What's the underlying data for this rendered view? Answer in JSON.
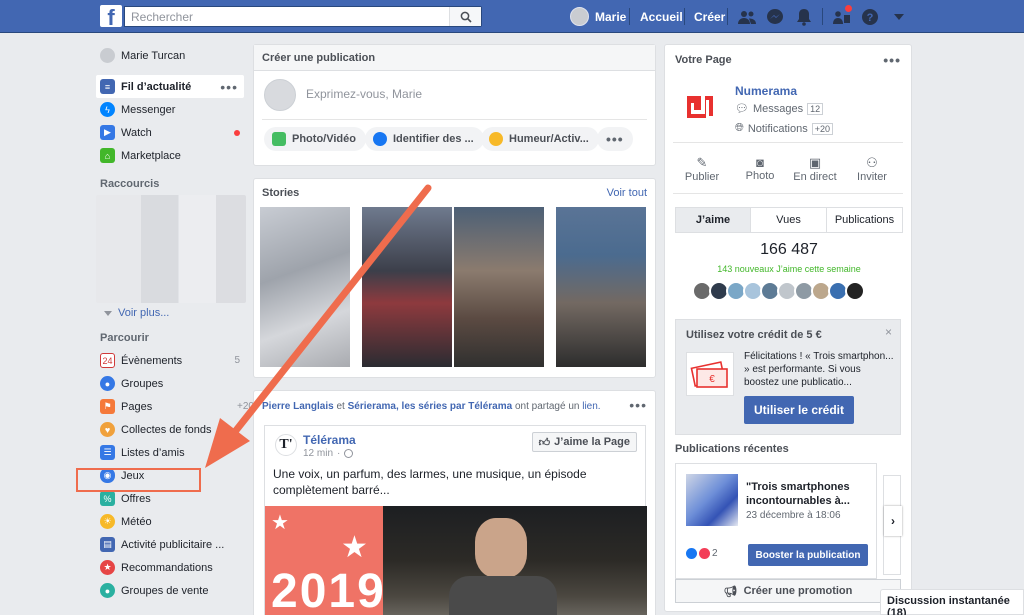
{
  "topbar": {
    "search_placeholder": "Rechercher",
    "user_name": "Marie",
    "home_label": "Accueil",
    "create_label": "Créer"
  },
  "leftnav": {
    "profile_name": "Marie Turcan",
    "main_items": [
      {
        "label": "Fil d’actualité",
        "icon": "news-feed-icon",
        "color": "#4267b2"
      },
      {
        "label": "Messenger",
        "icon": "messenger-icon",
        "color": "#0084ff"
      },
      {
        "label": "Watch",
        "icon": "watch-icon",
        "color": "#3578e5"
      },
      {
        "label": "Marketplace",
        "icon": "marketplace-icon",
        "color": "#42b72a"
      }
    ],
    "shortcuts_heading": "Raccourcis",
    "see_more": "Voir plus...",
    "explore_heading": "Parcourir",
    "explore_items": [
      {
        "label": "Évènements",
        "icon": "calendar-icon",
        "count": "5"
      },
      {
        "label": "Groupes",
        "icon": "groups-icon",
        "count": ""
      },
      {
        "label": "Pages",
        "icon": "pages-flag-icon",
        "count": "+20"
      },
      {
        "label": "Collectes de fonds",
        "icon": "fundraiser-icon",
        "count": ""
      },
      {
        "label": "Listes d’amis",
        "icon": "friend-lists-icon",
        "count": ""
      },
      {
        "label": "Jeux",
        "icon": "games-icon",
        "count": ""
      },
      {
        "label": "Offres",
        "icon": "offers-icon",
        "count": ""
      },
      {
        "label": "Météo",
        "icon": "weather-icon",
        "count": ""
      },
      {
        "label": "Activité publicitaire ...",
        "icon": "ad-activity-icon",
        "count": ""
      },
      {
        "label": "Recommandations",
        "icon": "recommendations-icon",
        "count": ""
      },
      {
        "label": "Groupes de vente",
        "icon": "sale-groups-icon",
        "count": ""
      }
    ]
  },
  "composer": {
    "title": "Créer une publication",
    "placeholder": "Exprimez-vous, Marie",
    "actions": [
      "Photo/Vidéo",
      "Identifier des ...",
      "Humeur/Activ..."
    ]
  },
  "stories": {
    "title": "Stories",
    "see_all": "Voir tout"
  },
  "post": {
    "author_1": "Pierre Langlais",
    "conj": "et",
    "author_2": "Sérierama, les séries par Télérama",
    "action": "ont partagé un",
    "object": "lien.",
    "page_name": "Télérama",
    "time": "12 min",
    "like_page": "J’aime la Page",
    "text": "Une voix, un parfum, des larmes, une musique, un épisode complètement barré...",
    "year_text": "2019"
  },
  "page_panel": {
    "title": "Votre Page",
    "page_name": "Numerama",
    "messages_label": "Messages",
    "messages_count": "12",
    "notifications_label": "Notifications",
    "notifications_count": "+20",
    "actions": [
      "Publier",
      "Photo",
      "En direct",
      "Inviter"
    ],
    "tabs": [
      "J’aime",
      "Vues",
      "Publications"
    ],
    "likes_total": "166 487",
    "likes_week": "143 nouveaux J’aime cette semaine",
    "promo_title": "Utilisez votre crédit de 5 €",
    "promo_text": "Félicitations ! « Trois smartphon... » est performante. Si vous boostez une publicatio...",
    "promo_button": "Utiliser le crédit",
    "recent_title": "Publications récentes",
    "recent_post_title": "\"Trois smartphones incontournables à...",
    "recent_post_date": "23 décembre à 18:06",
    "recent_reactions": "2",
    "boost_button": "Booster la publication",
    "create_promo": "Créer une promotion"
  },
  "chat": {
    "label": "Discussion instantanée (18)"
  },
  "colors": {
    "brand_blue": "#4267b2",
    "annotation": "#ef6c4d",
    "green": "#42b72a",
    "numerama_red": "#e8312f"
  }
}
